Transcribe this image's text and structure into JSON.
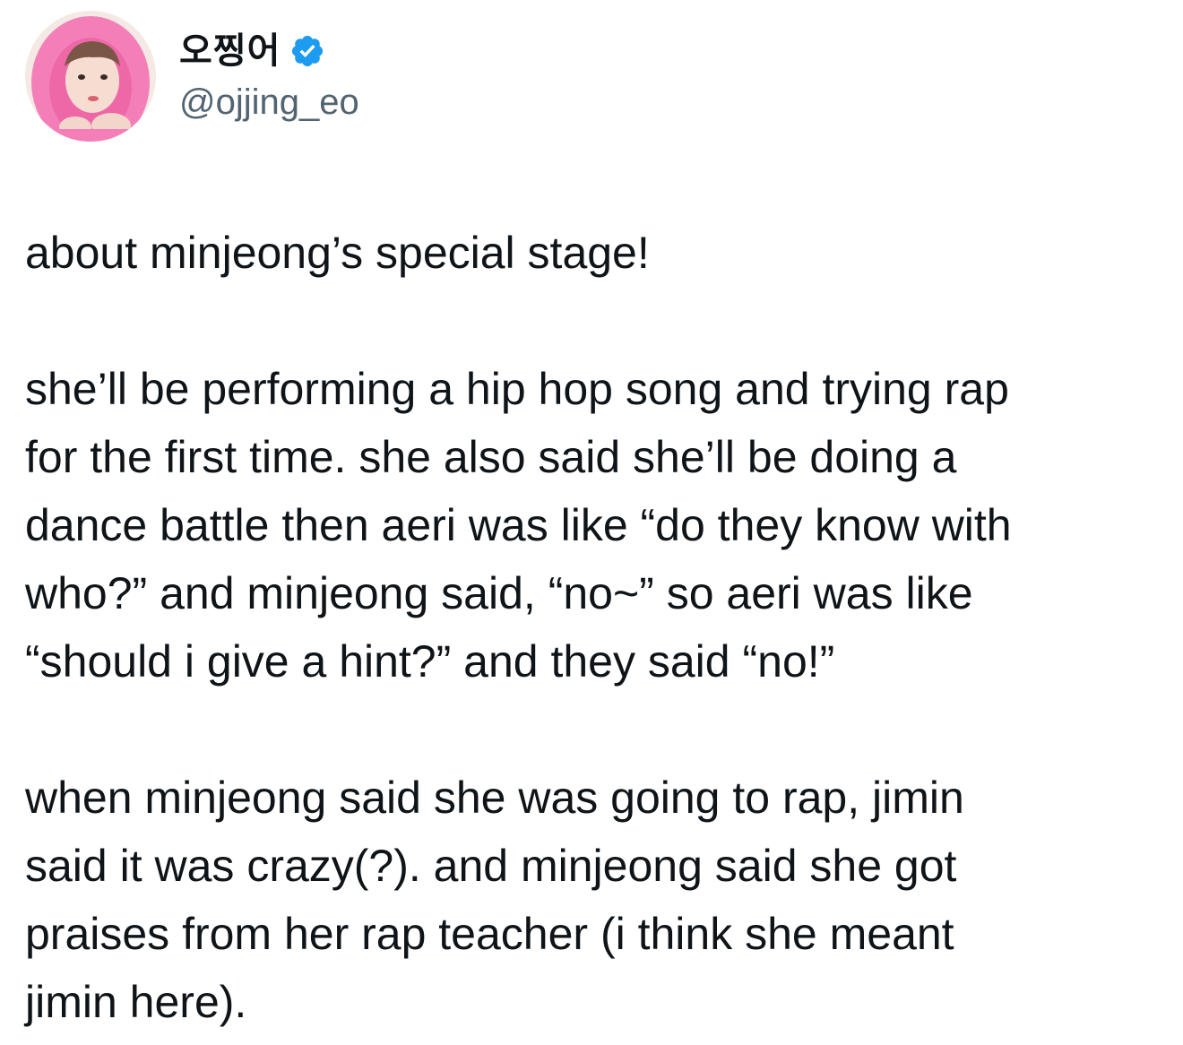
{
  "tweet": {
    "author": {
      "display_name": "오찡어",
      "handle": "@ojjing_eo",
      "verified": true,
      "avatar_icon": "avatar-photo",
      "verified_icon": "verified-badge-icon"
    },
    "paragraphs": [
      {
        "lines": [
          "about minjeong’s special stage!"
        ]
      },
      {
        "lines": [
          "she’ll be performing a hip hop song and trying rap",
          "for the first time. she also said she’ll be doing a",
          "dance battle then aeri was like “do they know with",
          "who?” and minjeong said, “no~” so aeri was like",
          "“should i give a hint?” and they said “no!”"
        ]
      },
      {
        "lines": [
          "when minjeong said she was going to rap, jimin",
          "said it was crazy(?). and minjeong said she got",
          "praises from her rap teacher (i think she meant",
          "jimin here)."
        ]
      }
    ]
  },
  "colors": {
    "text_primary": "#0f1419",
    "text_secondary": "#536471",
    "verified_blue": "#1d9bf0",
    "avatar_hood_pink": "#f47fb8"
  }
}
